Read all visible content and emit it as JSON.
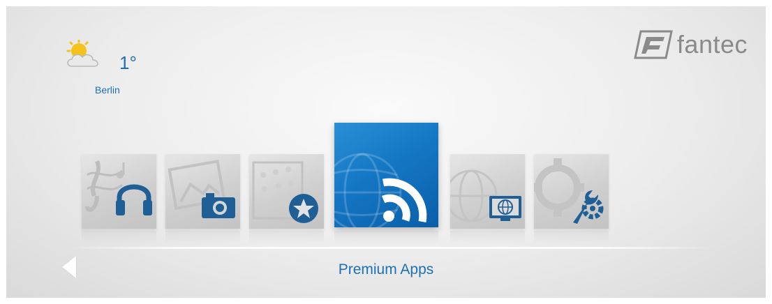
{
  "weather": {
    "icon": "partly-cloudy-sun-icon",
    "temperature": "1°",
    "city": "Berlin"
  },
  "brand": {
    "name": "fantec",
    "mark": "F"
  },
  "menu": {
    "selected": "Premium Apps",
    "items": [
      {
        "id": "music",
        "icon": "headphones-icon"
      },
      {
        "id": "photo",
        "icon": "camera-icon"
      },
      {
        "id": "movie",
        "icon": "star-icon"
      },
      {
        "id": "premium-apps",
        "icon": "rss-icon"
      },
      {
        "id": "network",
        "icon": "globe-monitor-icon"
      },
      {
        "id": "settings",
        "icon": "wrench-gear-icon"
      }
    ]
  },
  "colors": {
    "accent": "#1d6fb5",
    "tile_active": "#1477c4",
    "icon_dark": "#1f5f96"
  }
}
